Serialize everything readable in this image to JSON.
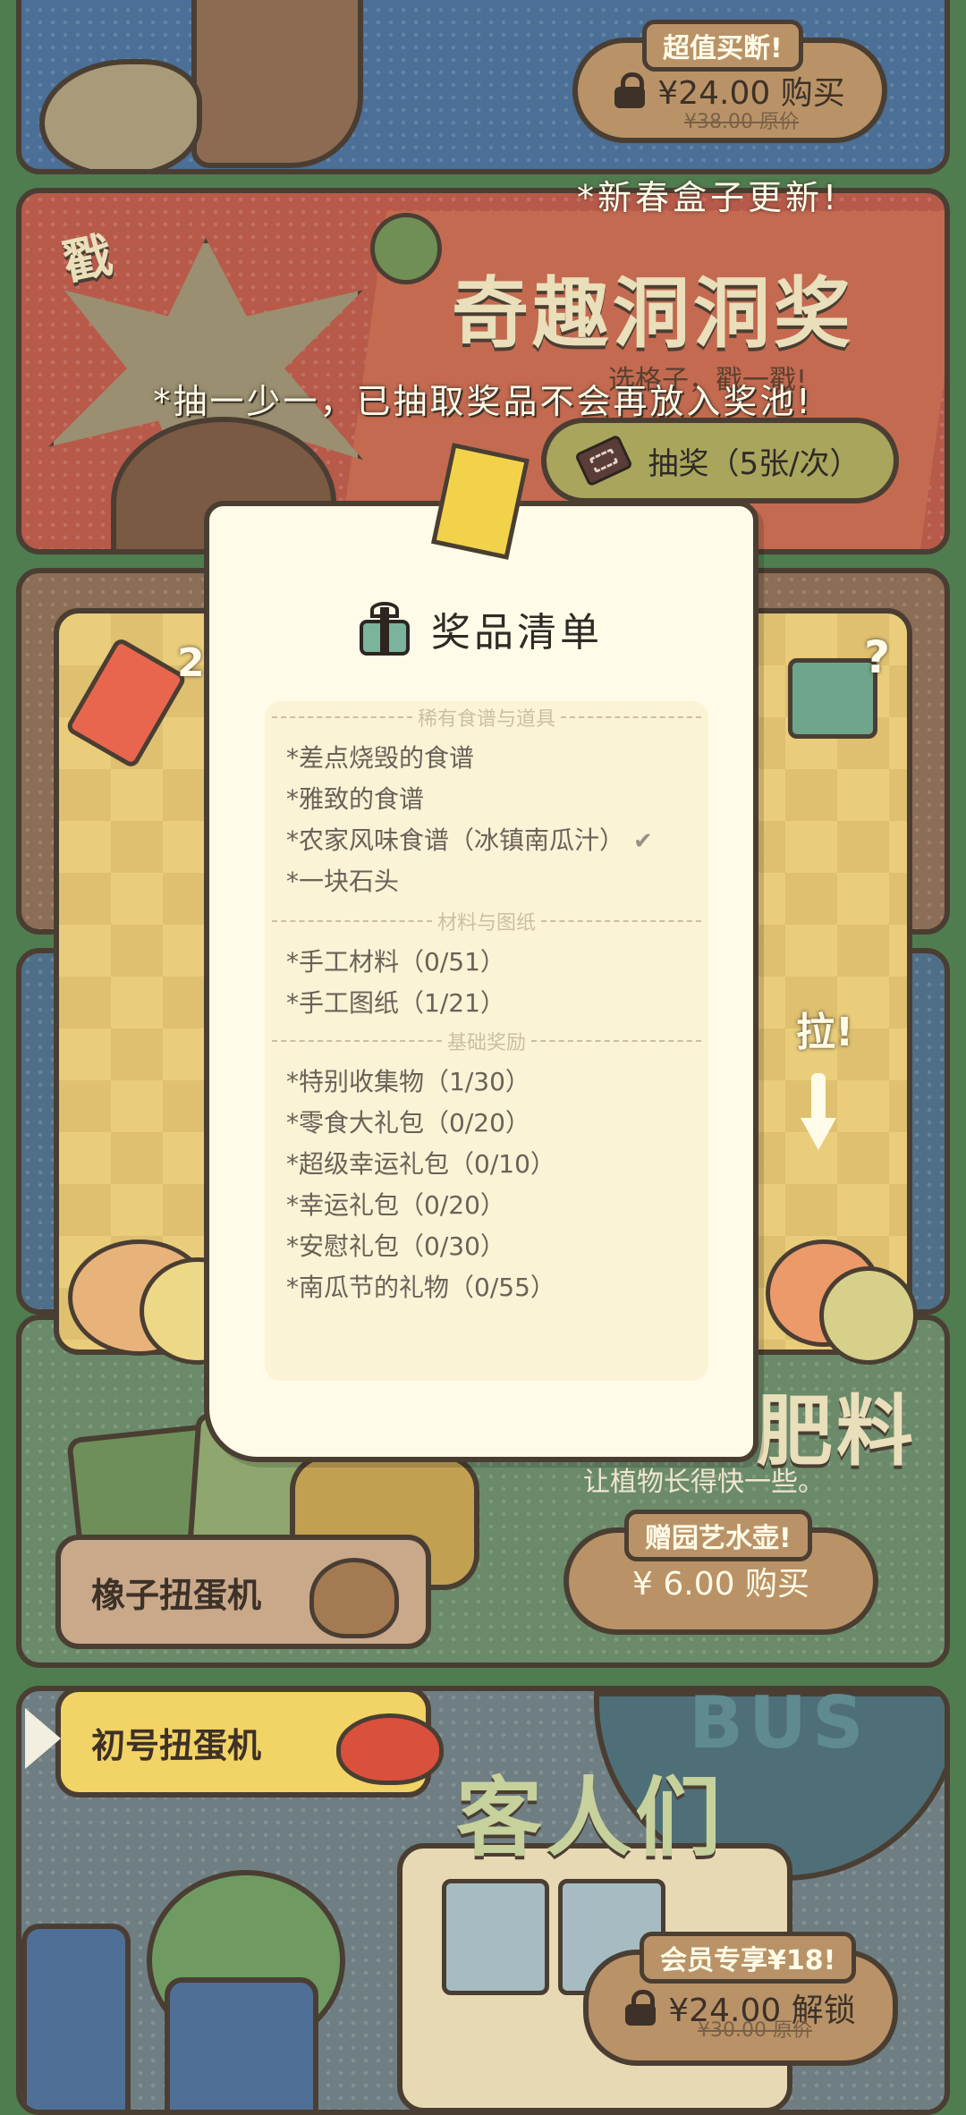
{
  "top_offer": {
    "tag": "超值买断!",
    "price": "¥24.00 购买",
    "original": "¥38.00 原价"
  },
  "new_box_notice": "*新春盒子更新!",
  "hole_prize": {
    "poke_text": "戳",
    "title": "奇趣洞洞奖",
    "subtitle": "选格子，戳一戳!",
    "notice": "*抽一少一，已抽取奖品不会再放入奖池!",
    "draw_button": "抽奖（5张/次）"
  },
  "machine": {
    "ticket_count": "2",
    "pull_label": "拉!"
  },
  "popup": {
    "title": "奖品清单",
    "sections": [
      {
        "header": "稀有食谱与道具",
        "items": [
          {
            "label": "*差点烧毁的食谱",
            "checked": false
          },
          {
            "label": "*雅致的食谱",
            "checked": false
          },
          {
            "label": "*农家风味食谱（冰镇南瓜汁）",
            "checked": true
          },
          {
            "label": "*一块石头",
            "checked": false
          }
        ]
      },
      {
        "header": "材料与图纸",
        "items": [
          {
            "label": "*手工材料（0/51）",
            "checked": false
          },
          {
            "label": "*手工图纸（1/21）",
            "checked": false
          }
        ]
      },
      {
        "header": "基础奖励",
        "items": [
          {
            "label": "*特别收集物（1/30）",
            "checked": false
          },
          {
            "label": "*零食大礼包（0/20）",
            "checked": false
          },
          {
            "label": "*超级幸运礼包（0/10）",
            "checked": false
          },
          {
            "label": "*幸运礼包（0/20）",
            "checked": false
          },
          {
            "label": "*安慰礼包（0/30）",
            "checked": false
          },
          {
            "label": "*南瓜节的礼物（0/55）",
            "checked": false
          }
        ]
      }
    ]
  },
  "fertilizer": {
    "title_fragment": "肥料",
    "description": "让植物长得快一些。",
    "tag": "赠园艺水壶!",
    "price": "¥ 6.00 购买"
  },
  "gacha": {
    "acorn": "橡子扭蛋机",
    "first": "初号扭蛋机"
  },
  "visitors": {
    "title_fragment": "客人们",
    "bus_text": "BUS",
    "tag": "会员专享¥18!",
    "price": "¥24.00 解锁",
    "original": "¥30.00 原价"
  },
  "colors": {
    "frame": "#4a3e33",
    "paper": "#fffbe8",
    "tan_button": "#b99367",
    "olive_button": "#a9a55c"
  }
}
